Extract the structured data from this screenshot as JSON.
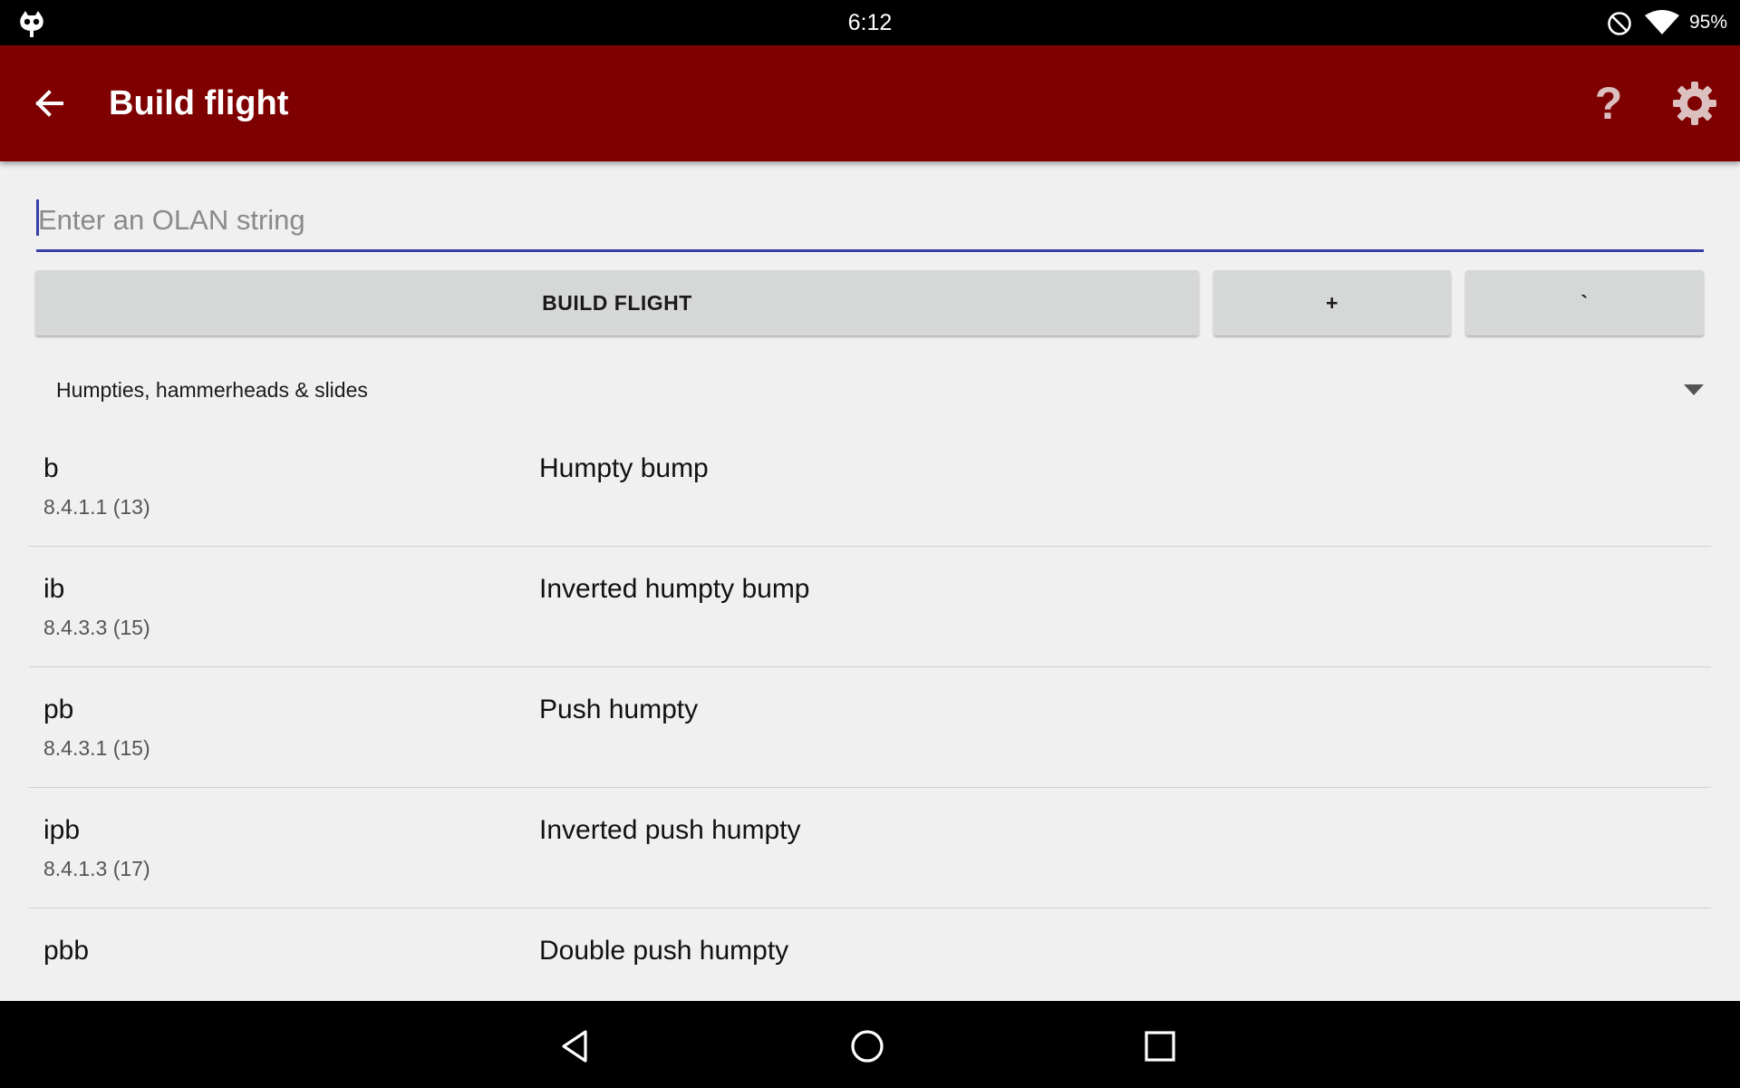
{
  "status_bar": {
    "time": "6:12",
    "battery": "95%",
    "icons": [
      "cyanogenmod-icon",
      "do-not-disturb-icon",
      "wifi-icon"
    ]
  },
  "app_bar": {
    "title": "Build flight",
    "help_label": "?",
    "icons": [
      "arrow-back-icon",
      "help-icon",
      "gear-icon"
    ],
    "color": "#7f0000"
  },
  "input": {
    "placeholder": "Enter an OLAN string",
    "value": ""
  },
  "buttons": {
    "build": "BUILD FLIGHT",
    "plus": "+",
    "tick": "`"
  },
  "category": {
    "selected": "Humpties, hammerheads & slides"
  },
  "figures": [
    {
      "code": "b",
      "ref": "8.4.1.1 (13)",
      "name": "Humpty bump"
    },
    {
      "code": "ib",
      "ref": "8.4.3.3 (15)",
      "name": "Inverted humpty bump"
    },
    {
      "code": "pb",
      "ref": "8.4.3.1 (15)",
      "name": "Push humpty"
    },
    {
      "code": "ipb",
      "ref": "8.4.1.3 (17)",
      "name": "Inverted push humpty"
    },
    {
      "code": "pbb",
      "ref": "",
      "name": "Double push humpty"
    }
  ],
  "nav_bar": {
    "icons": [
      "nav-back-icon",
      "nav-home-icon",
      "nav-recents-icon"
    ]
  }
}
